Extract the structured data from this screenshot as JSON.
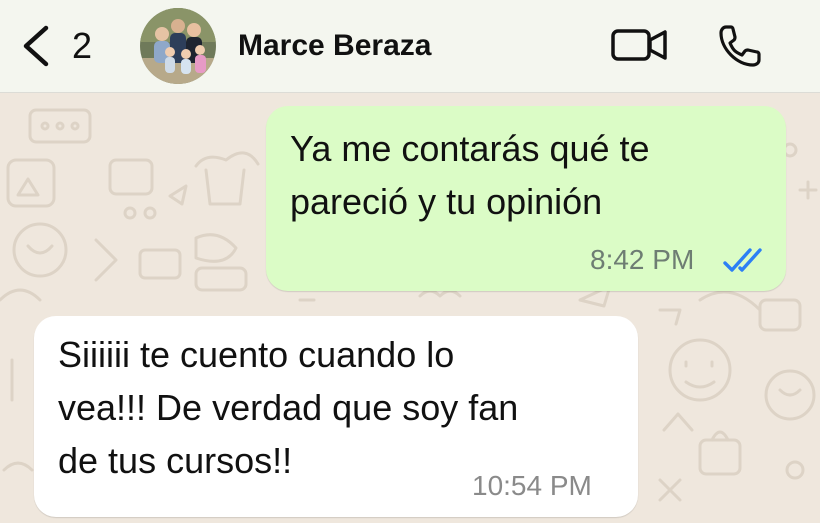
{
  "header": {
    "back_icon": "chevron-left-icon",
    "unread_count": "2",
    "contact_name": "Marce Beraza",
    "video_call_icon": "video-camera-icon",
    "voice_call_icon": "phone-icon"
  },
  "messages": [
    {
      "direction": "outgoing",
      "text": "Ya me contarás qué te\npareció y tu opinión",
      "time": "8:42 PM",
      "status_icon": "double-check-read-icon",
      "status_color": "#2c7ff5"
    },
    {
      "direction": "incoming",
      "text": "Siiiiii te cuento cuando lo\nvea!!! De verdad que soy fan\nde tus cursos!!",
      "time": "10:54 PM"
    }
  ],
  "colors": {
    "outgoing_bubble": "#dbfcc6",
    "incoming_bubble": "#ffffff",
    "wallpaper": "#efe7dd",
    "header_bg": "#f4f6ef"
  }
}
